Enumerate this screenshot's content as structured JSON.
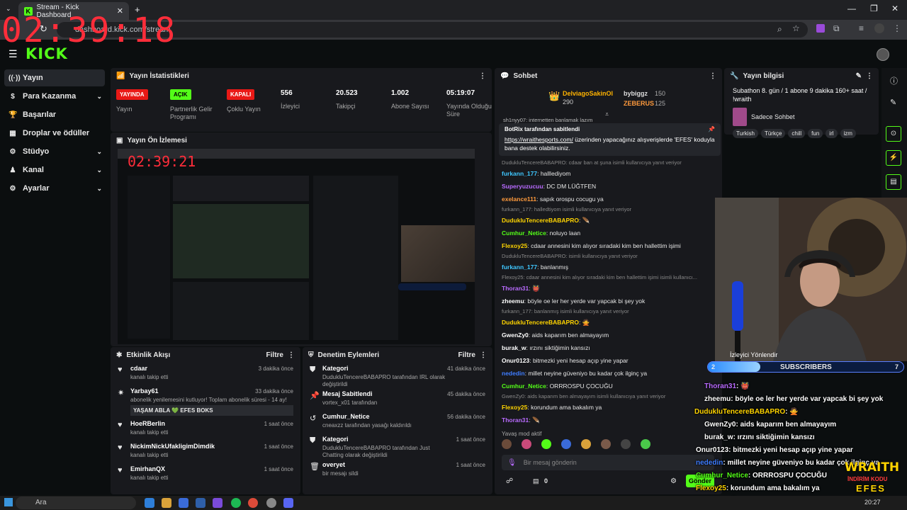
{
  "browser": {
    "tab_title": "Stream - Kick Dashboard",
    "url": "dashboard.kick.com/stream"
  },
  "overlay": {
    "clock": "02:39:18",
    "clock_preview": "02:39:21"
  },
  "sidebar": {
    "items": [
      {
        "label": "Yayın",
        "icon": "wave-icon",
        "chev": false,
        "active": true
      },
      {
        "label": "Para Kazanma",
        "icon": "dollar-icon",
        "chev": true
      },
      {
        "label": "Başarılar",
        "icon": "trophy-icon",
        "chev": false
      },
      {
        "label": "Droplar ve ödüller",
        "icon": "gift-icon",
        "chev": false
      },
      {
        "label": "Stüdyo",
        "icon": "gear-icon",
        "chev": true
      },
      {
        "label": "Kanal",
        "icon": "user-icon",
        "chev": true
      },
      {
        "label": "Ayarlar",
        "icon": "settings-icon",
        "chev": true
      }
    ]
  },
  "stats": {
    "title": "Yayın İstatistikleri",
    "items": [
      {
        "badge": "YAYINDA",
        "badge_color": "#e91916",
        "label": "Yayın"
      },
      {
        "badge": "AÇIK",
        "badge_color": "#53fc18",
        "label": "Partnerlik Gelir Programı"
      },
      {
        "badge": "KAPALI",
        "badge_color": "#e91916",
        "label": "Çoklu Yayın"
      },
      {
        "num": "556",
        "label": "İzleyici"
      },
      {
        "num": "20.523",
        "label": "Takipçi"
      },
      {
        "num": "1.002",
        "label": "Abone Sayısı"
      },
      {
        "num": "05:19:07",
        "label": "Yayında Olduğu Süre"
      }
    ]
  },
  "preview": {
    "title": "Yayın Ön İzlemesi"
  },
  "activity": {
    "title": "Etkinlik Akışı",
    "filter": "Filtre",
    "rows": [
      {
        "name": "cdaar",
        "sub": "kanalı takip etti",
        "time": "3 dakika önce"
      },
      {
        "name": "Yarbay61",
        "sub": "abonelik yenilemesini kutluyor! Toplam abonelik süresi - 14 ay!",
        "time": "33 dakika önce",
        "note": "YAŞAM ABLA 💚 EFES BOKS"
      },
      {
        "name": "HoeRBerlin",
        "sub": "kanalı takip etti",
        "time": "1 saat önce"
      },
      {
        "name": "NickimNickUfakligimDimdik",
        "sub": "kanalı takip etti",
        "time": "1 saat önce"
      },
      {
        "name": "EmirhanQX",
        "sub": "kanalı takip etti",
        "time": "1 saat önce"
      }
    ]
  },
  "moderation": {
    "title": "Denetim Eylemleri",
    "filter": "Filtre",
    "rows": [
      {
        "name": "Kategori",
        "sub": "DudukluTencereBABAPRO tarafından IRL olarak değiştirildi",
        "time": "41 dakika önce"
      },
      {
        "name": "Mesaj Sabitlendi",
        "sub": "vortex_x01 tarafından",
        "time": "45 dakika önce"
      },
      {
        "name": "Cumhur_Netice",
        "sub": "cneaxzz tarafından yasağı kaldırıldı",
        "time": "56 dakika önce"
      },
      {
        "name": "Kategori",
        "sub": "DudukluTencereBABAPRO tarafından Just Chatting olarak değiştirildi",
        "time": "1 saat önce"
      },
      {
        "name": "overyet",
        "sub": "bir mesajı sildi",
        "time": "1 saat önce"
      }
    ]
  },
  "chat": {
    "title": "Sohbet",
    "leader1": {
      "name": "DelviagoSakinOl",
      "pts": "290"
    },
    "leader2": {
      "name": "bybiggz",
      "pts": "150"
    },
    "leader3": {
      "name": "ZEBERUS",
      "pts": "125"
    },
    "cut": "sh1nyy07: internetten banlamak lazım",
    "pinned_by": "BotRix tarafından sabitlendi",
    "pinned_link": "https://wraithesports.com/",
    "pinned_text": " üzerinden yapacağınız alışverişlerde 'EFES' koduyla bana destek olabilirsiniz.",
    "mode": "Yavaş mod aktif",
    "placeholder": "Bir mesaj gönderin",
    "viewers": "0",
    "send": "Gönder",
    "lines": [
      {
        "r": "DudukluTencereBABAPRO: cdaar ban at şuna isimli kullanıcıya yanıt veriyor"
      },
      {
        "u": "furkann_177",
        "c": "#3fc7ff",
        "m": "halllediyom"
      },
      {
        "u": "Superyuzucuu",
        "c": "#b96bff",
        "m": "DC DM LÜĞTFEN"
      },
      {
        "u": "exelance111",
        "c": "#ff9a3c",
        "m": "sapık orospu cocugu ya"
      },
      {
        "r": "furkann_177: halledtiyom isimli kullanıcıya yanıt veriyor"
      },
      {
        "u": "DudukluTencereBABAPRO",
        "c": "#ffd400",
        "m": "🪶"
      },
      {
        "u": "Cumhur_Netice",
        "c": "#53fc18",
        "m": "noluyo laan"
      },
      {
        "u": "Flexoy25",
        "c": "#ffd400",
        "m": "cdaar annesini kim alıyor sıradaki kim ben hallettim işimi"
      },
      {
        "r": "DudukluTencereBABAPRO: isimli kullanıcıya yanıt veriyor"
      },
      {
        "u": "furkann_177",
        "c": "#3fc7ff",
        "m": "banlanmış"
      },
      {
        "r": "Flexoy25: cdaar annesini kim alıyor sıradaki kim ben hallettim işimi isimli kullanıcı..."
      },
      {
        "u": "Thoran31",
        "c": "#b96bff",
        "m": "👹"
      },
      {
        "u": "zheemu",
        "c": "#ffffff",
        "m": "böyle oe ler her yerde var yapcak bi şey yok"
      },
      {
        "r": "furkann_177: banlanmış isimli kullanıcıya yanıt veriyor"
      },
      {
        "u": "DudukluTencereBABAPRO",
        "c": "#ffd400",
        "m": "🙅"
      },
      {
        "u": "GwenZy0",
        "c": "#ffffff",
        "m": "aids kaparım ben almayayım"
      },
      {
        "u": "burak_w",
        "c": "#ffffff",
        "m": "ırzını siktiğimin kansızı"
      },
      {
        "u": "Onur0123",
        "c": "#ffffff",
        "m": "bitmezki yeni hesap açıp yine yapar"
      },
      {
        "u": "nededin",
        "c": "#3f7dff",
        "m": "millet neyine güveniyo bu kadar çok ilginç ya"
      },
      {
        "u": "Cumhur_Netice",
        "c": "#53fc18",
        "m": "ORRROSPU ÇOCUĞU"
      },
      {
        "r": "GwenZy0: aids kaparım ben almayayım isimli kullanıcıya yanıt veriyor"
      },
      {
        "u": "Flexoy25",
        "c": "#ffd400",
        "m": "korundum ama bakalım ya"
      },
      {
        "u": "Thoran31",
        "c": "#b96bff",
        "m": "🪶"
      }
    ]
  },
  "info": {
    "title": "Yayın bilgisi",
    "text": "Subathon 8. gün / 1 abone 9 dakika 160+ saat / !wraith",
    "category": "Sadece Sohbet",
    "tags": [
      "Turkish",
      "Türkçe",
      "chill",
      "fun",
      "irl",
      "izm"
    ]
  },
  "overlay_chat": {
    "viewer_dir": "İzleyici Yönlendir",
    "subs": "SUBSCRIBERS",
    "subs_left": "2",
    "subs_right": "7",
    "lines": [
      {
        "u": "Thoran31",
        "c": "#b96bff",
        "m": ": 👹"
      },
      {
        "u": "zheemu",
        "c": "#ffffff",
        "m": ": böyle oe ler her yerde var yapcak bi şey yok"
      },
      {
        "u": "DudukluTencereBABAPRO",
        "c": "#ffd400",
        "m": ": 🙅"
      },
      {
        "u": "GwenZy0",
        "c": "#ffffff",
        "m": ": aids kaparım ben almayayım"
      },
      {
        "u": "burak_w",
        "c": "#ffffff",
        "m": ": ırzını siktiğimin kansızı"
      },
      {
        "u": "Onur0123",
        "c": "#ffffff",
        "m": ": bitmezki yeni hesap açıp yine yapar"
      },
      {
        "u": "nededin",
        "c": "#3f7dff",
        "m": ": millet neyine güveniyo bu kadar çok ilginç ya"
      },
      {
        "u": "Cumhur_Netice",
        "c": "#53fc18",
        "m": ": ORRROSPU ÇOCUĞU"
      },
      {
        "u": "Flexoy25",
        "c": "#ffd400",
        "m": ": korundum ama bakalım ya"
      },
      {
        "u": "Thoran31",
        "c": "#b96bff",
        "m": ": 🪶"
      }
    ],
    "brand": "WRAITH",
    "brand_sub": "İNDİRİM KODU",
    "brand_code": "EFES"
  },
  "taskbar": {
    "search": "Ara",
    "time": "20:27"
  }
}
